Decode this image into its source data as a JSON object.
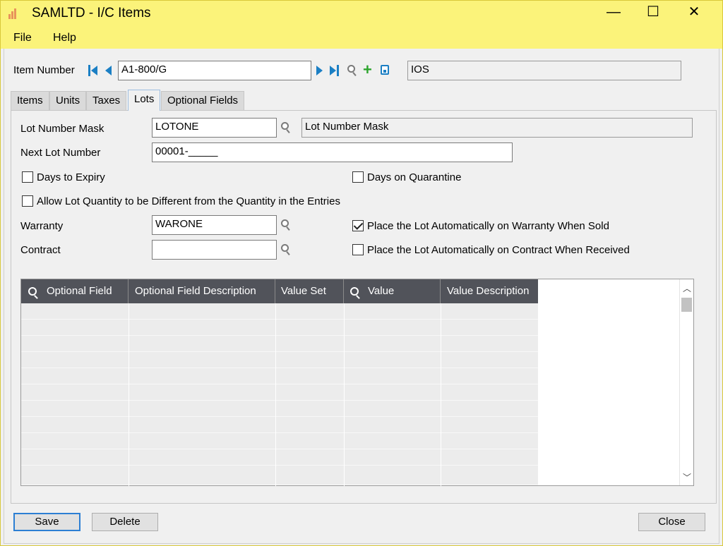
{
  "window": {
    "title": "SAMLTD - I/C Items",
    "controls": {
      "minimize": "—",
      "maximize": "☐",
      "close": "✕"
    }
  },
  "menu": {
    "file": "File",
    "help": "Help"
  },
  "item": {
    "label": "Item Number",
    "number": "A1-800/G",
    "description": "IOS"
  },
  "tabs": [
    {
      "label": "Items"
    },
    {
      "label": "Units"
    },
    {
      "label": "Taxes"
    },
    {
      "label": "Lots"
    },
    {
      "label": "Optional Fields"
    }
  ],
  "active_tab": "Lots",
  "lots": {
    "lot_mask_label": "Lot Number Mask",
    "lot_mask_value": "LOTONE",
    "lot_mask_description": "Lot Number Mask",
    "next_lot_label": "Next Lot Number",
    "next_lot_value": "00001-_____",
    "days_to_expiry": {
      "label": "Days to Expiry",
      "checked": false
    },
    "days_on_quarantine": {
      "label": "Days on Quarantine",
      "checked": false
    },
    "allow_lot_qty": {
      "label": "Allow Lot Quantity to be Different from the Quantity in the Entries",
      "checked": false
    },
    "warranty_label": "Warranty",
    "warranty_value": "WARONE",
    "contract_label": "Contract",
    "contract_value": "",
    "auto_warranty": {
      "label": "Place the Lot Automatically on Warranty When Sold",
      "checked": true
    },
    "auto_contract": {
      "label": "Place the Lot Automatically on Contract When Received",
      "checked": false
    }
  },
  "grid": {
    "columns": [
      {
        "label": "Optional Field",
        "lookup": true
      },
      {
        "label": "Optional Field Description",
        "lookup": false
      },
      {
        "label": "Value Set",
        "lookup": false
      },
      {
        "label": "Value",
        "lookup": true
      },
      {
        "label": "Value Description",
        "lookup": false
      }
    ],
    "rows": []
  },
  "buttons": {
    "save": "Save",
    "delete": "Delete",
    "close": "Close"
  },
  "colors": {
    "titlebar": "#fbf37a",
    "nav_accent": "#1b7fc4",
    "grid_header": "#51535a",
    "add_green": "#2ea52e"
  }
}
